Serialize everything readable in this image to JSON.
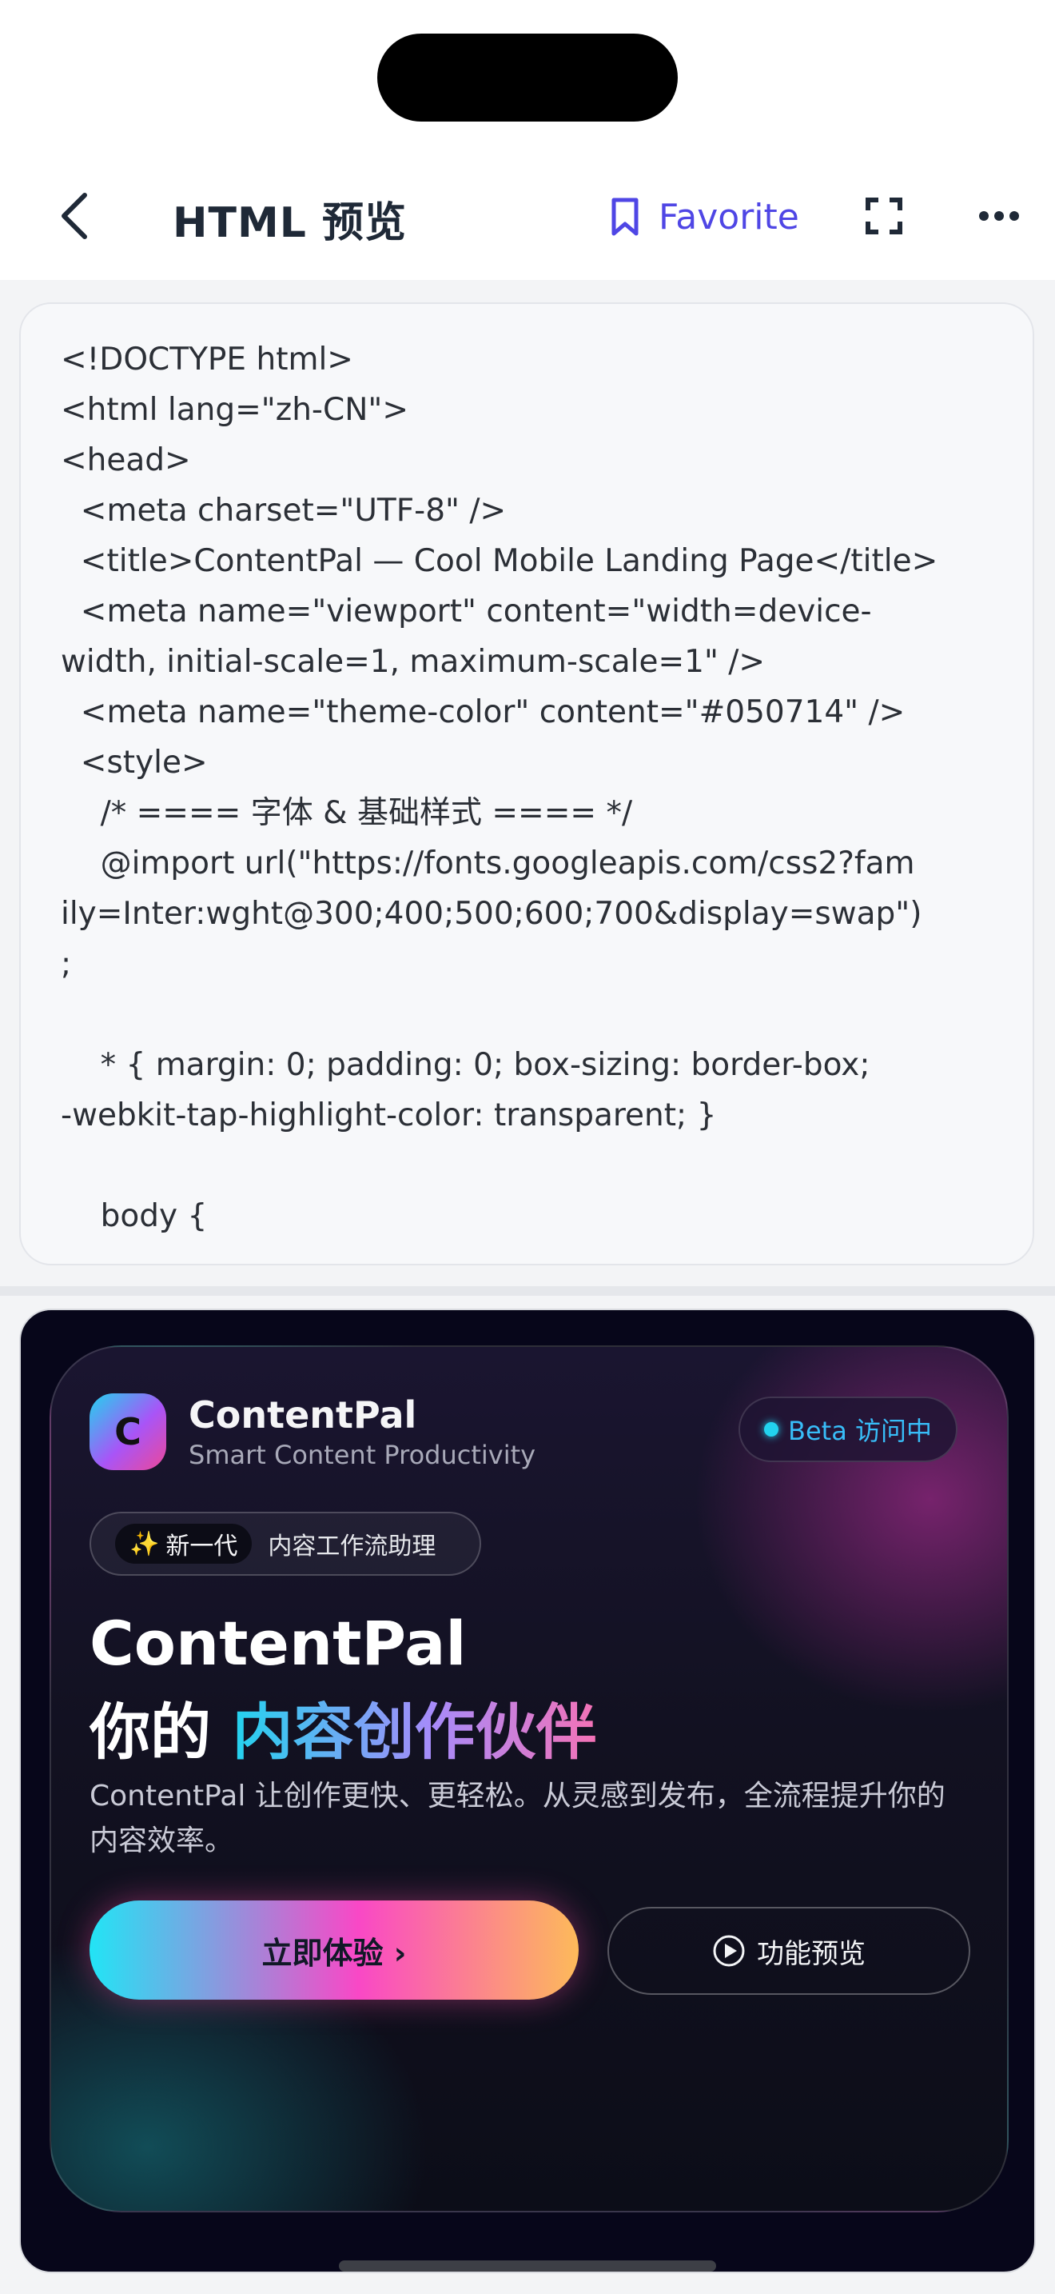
{
  "nav": {
    "title": "HTML 预览",
    "favorite_label": "Favorite"
  },
  "colors": {
    "accent": "#4f46e5",
    "preview_bg": "#07061a",
    "beta_text": "#38bdf8"
  },
  "icons": {
    "back": "chevron-left-icon",
    "favorite": "bookmark-icon",
    "expand": "expand-icon",
    "more": "more-horizontal-icon",
    "play": "play-circle-icon"
  },
  "code": {
    "lines": [
      "<!DOCTYPE html>",
      "<html lang=\"zh-CN\">",
      "<head>",
      "  <meta charset=\"UTF-8\" />",
      "  <title>ContentPal — Cool Mobile Landing Page</title>",
      "  <meta name=\"viewport\" content=\"width=device-",
      "width, initial-scale=1, maximum-scale=1\" />",
      "  <meta name=\"theme-color\" content=\"#050714\" />",
      "  <style>",
      "    /* ==== 字体 & 基础样式 ==== */",
      "    @import url(\"https://fonts.googleapis.com/css2?fam",
      "ily=Inter:wght@300;400;500;600;700&display=swap\")",
      ";",
      "",
      "    * { margin: 0; padding: 0; box-sizing: border-box;",
      "-webkit-tap-highlight-color: transparent; }",
      "",
      "    body {"
    ]
  },
  "preview": {
    "logo_letter": "C",
    "brand_name": "ContentPal",
    "brand_tagline": "Smart Content Productivity",
    "beta_label": "Beta 访问中",
    "feature_tag": "新一代",
    "feature_spark": "✨",
    "feature_text": "内容工作流助理",
    "hero_line1": "ContentPal",
    "hero_line2_prefix": "你的 ",
    "hero_line2_highlight": "内容创作伙伴",
    "description": "ContentPal 让创作更快、更轻松。从灵感到发布，全流程提升你的内容效率。",
    "cta_primary": "立即体验 ›",
    "cta_secondary": "功能预览"
  }
}
